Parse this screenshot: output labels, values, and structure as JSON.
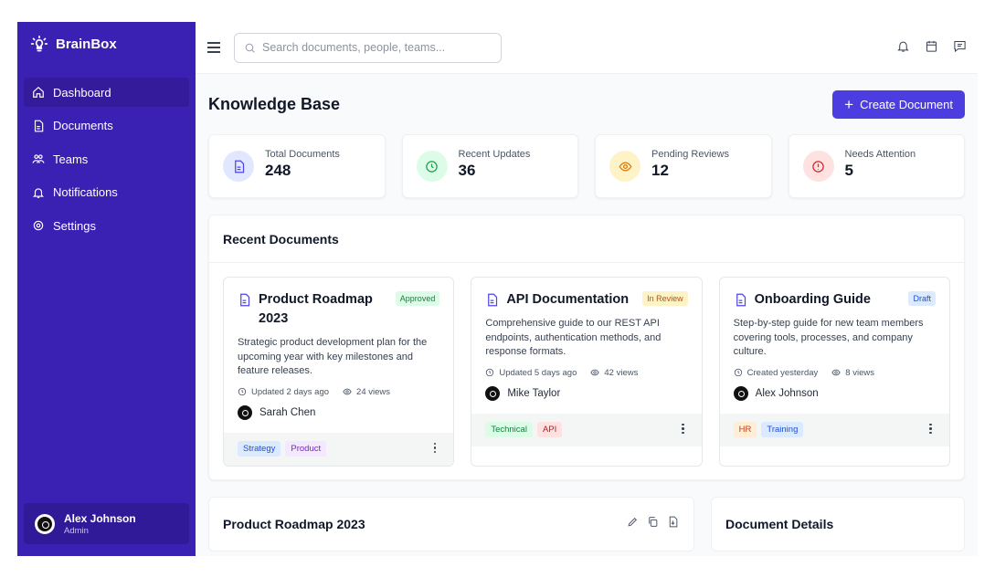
{
  "brand": {
    "name": "BrainBox",
    "icon": "lightbulb-icon"
  },
  "sidebar": {
    "items": [
      {
        "label": "Dashboard",
        "icon": "home-icon",
        "active": true
      },
      {
        "label": "Documents",
        "icon": "document-icon"
      },
      {
        "label": "Teams",
        "icon": "users-icon"
      },
      {
        "label": "Notifications",
        "icon": "bell-icon"
      },
      {
        "label": "Settings",
        "icon": "gear-icon"
      }
    ],
    "user": {
      "name": "Alex Johnson",
      "role": "Admin"
    }
  },
  "search": {
    "placeholder": "Search documents, people, teams..."
  },
  "header": {
    "icons": [
      "bell-icon",
      "calendar-icon",
      "message-icon"
    ]
  },
  "page": {
    "title": "Knowledge Base",
    "create_label": "Create Document"
  },
  "stats": [
    {
      "label": "Total Documents",
      "value": "248",
      "icon": "document-icon",
      "bg": "#e0e7ff",
      "fg": "#4f46e5"
    },
    {
      "label": "Recent Updates",
      "value": "36",
      "icon": "clock-icon",
      "bg": "#dcfce7",
      "fg": "#16a34a"
    },
    {
      "label": "Pending Reviews",
      "value": "12",
      "icon": "eye-icon",
      "bg": "#fef3c7",
      "fg": "#d97706"
    },
    {
      "label": "Needs Attention",
      "value": "5",
      "icon": "alert-icon",
      "bg": "#fee2e2",
      "fg": "#dc2626"
    }
  ],
  "recent": {
    "title": "Recent Documents",
    "cards": [
      {
        "title": "Product Roadmap 2023",
        "status": "Approved",
        "desc": "Strategic product development plan for the upcoming year with key milestones and feature releases.",
        "updated": "Updated 2 days ago",
        "views": "24 views",
        "author": "Sarah Chen",
        "tags": [
          "Strategy",
          "Product"
        ]
      },
      {
        "title": "API Documentation",
        "status": "In Review",
        "desc": "Comprehensive guide to our REST API endpoints, authentication methods, and response formats.",
        "updated": "Updated 5 days ago",
        "views": "42 views",
        "author": "Mike Taylor",
        "tags": [
          "Technical",
          "API"
        ]
      },
      {
        "title": "Onboarding Guide",
        "status": "Draft",
        "desc": "Step-by-step guide for new team members covering tools, processes, and company culture.",
        "updated": "Created yesterday",
        "views": "8 views",
        "author": "Alex Johnson",
        "tags": [
          "HR",
          "Training"
        ]
      }
    ]
  },
  "detail": {
    "title": "Product Roadmap 2023",
    "actions": [
      "edit-icon",
      "copy-icon",
      "download-icon"
    ]
  },
  "side_panel": {
    "title": "Document Details"
  },
  "colors": {
    "sidebar": "#3b20b4",
    "accent": "#4c3de0"
  }
}
